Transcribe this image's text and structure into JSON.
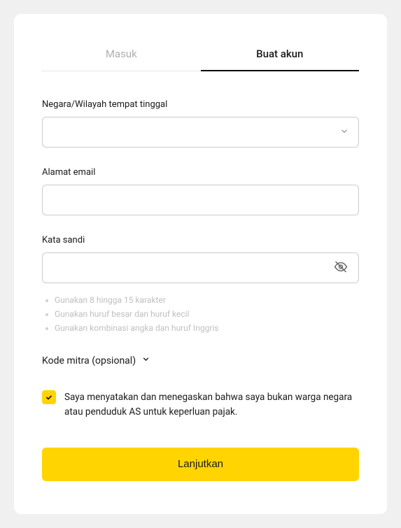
{
  "tabs": {
    "login": "Masuk",
    "signup": "Buat akun"
  },
  "fields": {
    "country": {
      "label": "Negara/Wilayah tempat tinggal",
      "value": ""
    },
    "email": {
      "label": "Alamat email",
      "value": ""
    },
    "password": {
      "label": "Kata sandi",
      "value": ""
    }
  },
  "password_hints": [
    "Gunakan 8 hingga 15 karakter",
    "Gunakan huruf besar dan huruf kecil",
    "Gunakan kombinasi angka dan huruf Inggris"
  ],
  "partner_code": {
    "label": "Kode mitra (opsional)"
  },
  "declaration": {
    "checked": true,
    "text": "Saya menyatakan dan menegaskan bahwa saya bukan warga negara atau penduduk AS untuk keperluan pajak."
  },
  "submit_label": "Lanjutkan"
}
